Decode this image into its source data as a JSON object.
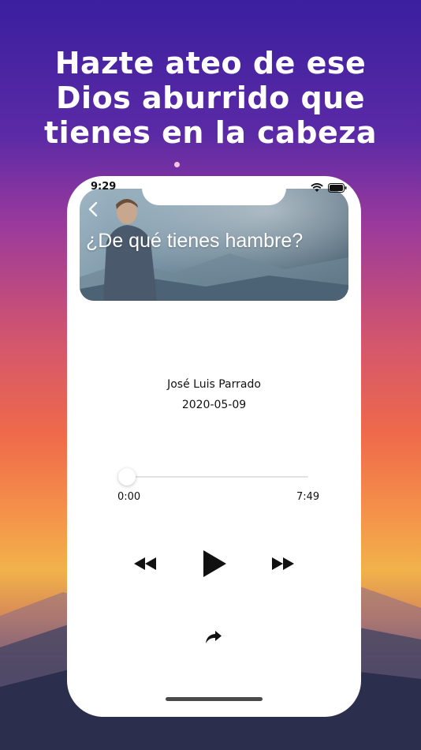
{
  "headline": {
    "line1": "Hazte ateo de ese",
    "line2": "Dios aburrido que",
    "line3": "tienes en la cabeza"
  },
  "status_bar": {
    "time": "9:29"
  },
  "episode": {
    "title": "¿De qué tienes hambre?",
    "author": "José Luis Parrado",
    "date": "2020-05-09"
  },
  "player": {
    "current_time": "0:00",
    "duration": "7:49",
    "progress": 0
  },
  "icons": {
    "back": "chevron-left-icon",
    "rewind": "rewind-icon",
    "play": "play-icon",
    "forward": "fast-forward-icon",
    "share": "share-icon",
    "wifi": "wifi-icon",
    "battery": "battery-icon"
  }
}
